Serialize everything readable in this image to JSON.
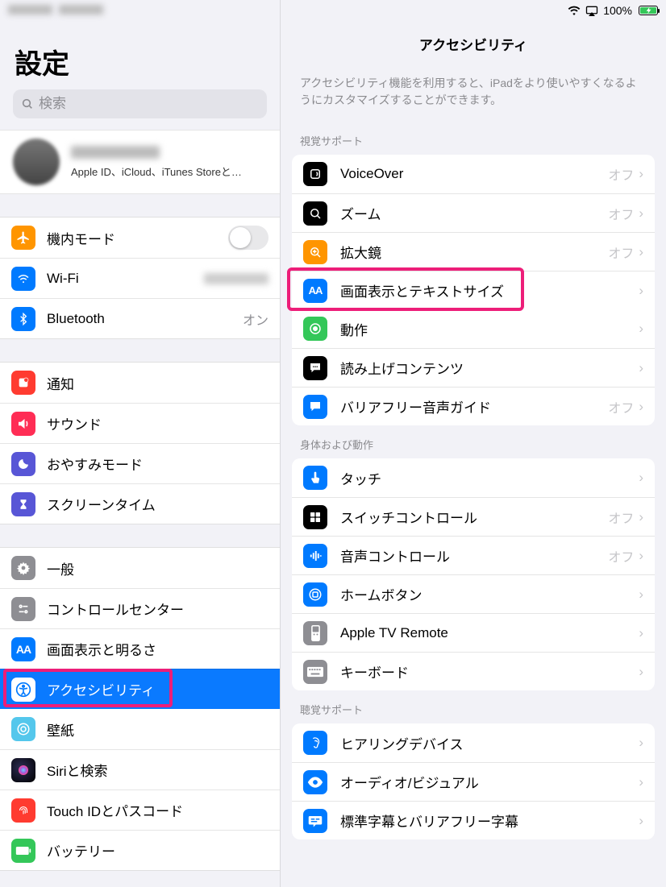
{
  "status": {
    "battery": "100%"
  },
  "sidebar": {
    "title": "設定",
    "search_placeholder": "検索",
    "account_sub": "Apple ID、iCloud、iTunes Storeと…",
    "group1": {
      "airplane": "機内モード",
      "wifi": "Wi-Fi",
      "bluetooth": "Bluetooth",
      "bluetooth_status": "オン"
    },
    "group2": {
      "notifications": "通知",
      "sounds": "サウンド",
      "dnd": "おやすみモード",
      "screentime": "スクリーンタイム"
    },
    "group3": {
      "general": "一般",
      "control": "コントロールセンター",
      "display": "画面表示と明るさ",
      "accessibility": "アクセシビリティ",
      "wallpaper": "壁紙",
      "siri": "Siriと検索",
      "touchid": "Touch IDとパスコード",
      "battery": "バッテリー"
    }
  },
  "main": {
    "title": "アクセシビリティ",
    "desc": "アクセシビリティ機能を利用すると、iPadをより使いやすくなるようにカスタマイズすることができます。",
    "off": "オフ",
    "sect1": "視覚サポート",
    "vision": {
      "voiceover": "VoiceOver",
      "zoom": "ズーム",
      "magnifier": "拡大鏡",
      "display": "画面表示とテキストサイズ",
      "motion": "動作",
      "spoken": "読み上げコンテンツ",
      "audiodesc": "バリアフリー音声ガイド"
    },
    "sect2": "身体および動作",
    "motor": {
      "touch": "タッチ",
      "switch": "スイッチコントロール",
      "voice": "音声コントロール",
      "home": "ホームボタン",
      "tv": "Apple TV Remote",
      "keyboard": "キーボード"
    },
    "sect3": "聴覚サポート",
    "hearing": {
      "devices": "ヒアリングデバイス",
      "audio": "オーディオ/ビジュアル",
      "subs": "標準字幕とバリアフリー字幕"
    }
  }
}
